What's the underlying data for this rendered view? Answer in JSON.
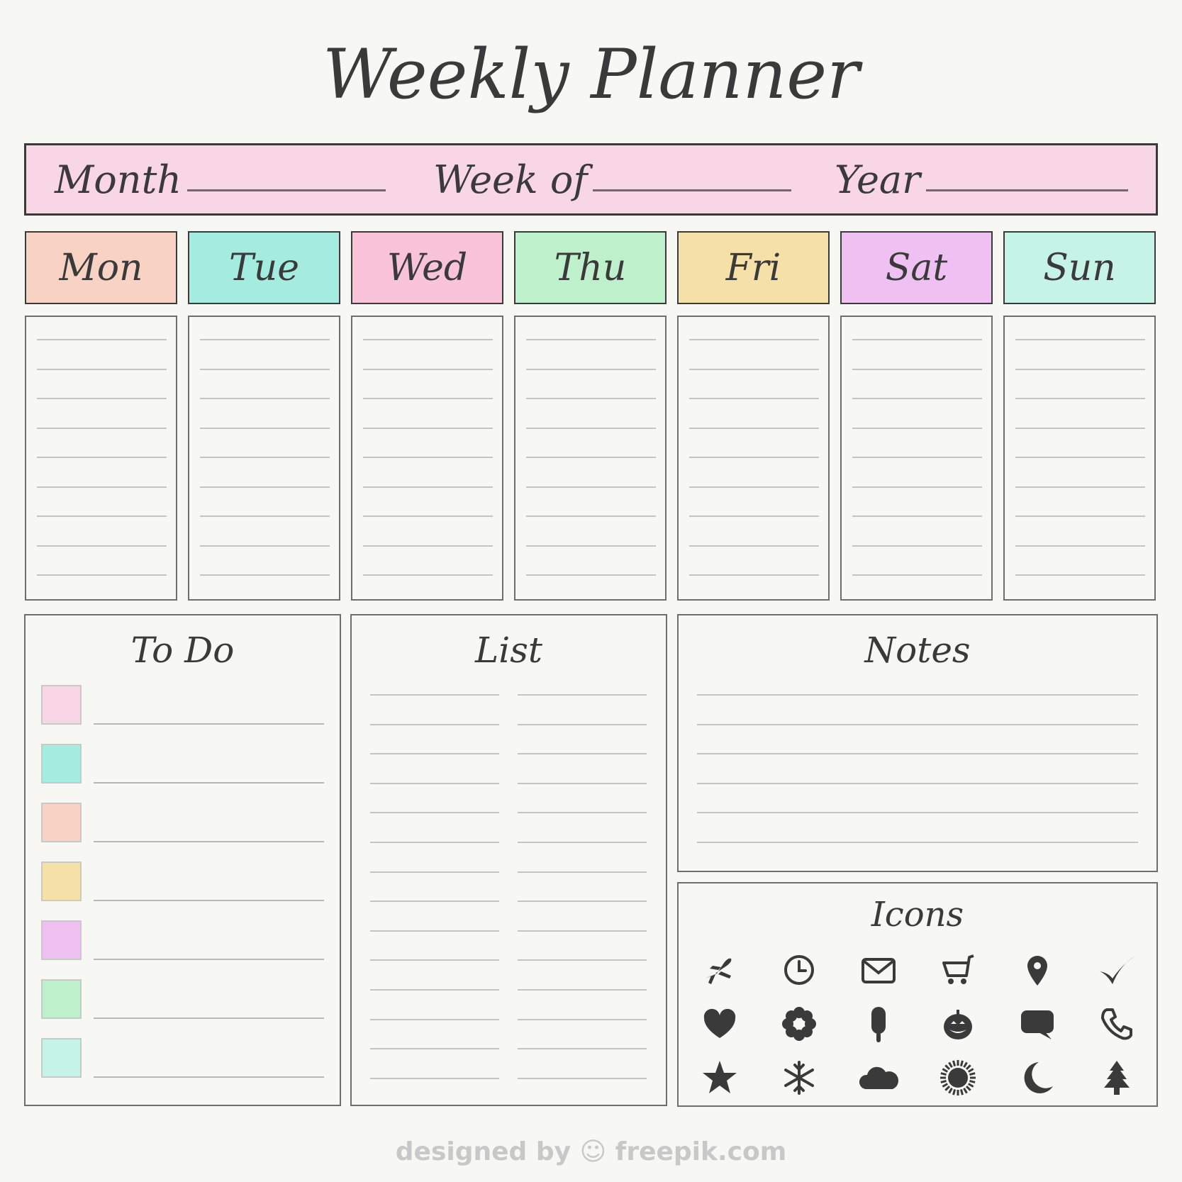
{
  "title": "Weekly Planner",
  "header": {
    "fields": [
      {
        "label": "Month"
      },
      {
        "label": "Week of"
      },
      {
        "label": "Year"
      }
    ],
    "color": "#f9d6e6"
  },
  "days": [
    {
      "label": "Mon",
      "color": "#f8d2c3"
    },
    {
      "label": "Tue",
      "color": "#a5ece0"
    },
    {
      "label": "Wed",
      "color": "#f9c3da"
    },
    {
      "label": "Thu",
      "color": "#bff0cc"
    },
    {
      "label": "Fri",
      "color": "#f5e0a8"
    },
    {
      "label": "Sat",
      "color": "#efc1f3"
    },
    {
      "label": "Sun",
      "color": "#c5f3e6"
    }
  ],
  "todo": {
    "title": "To Do",
    "colors": [
      "#f9d6e6",
      "#a5ece0",
      "#f8d2c3",
      "#f5e0a8",
      "#efc1f3",
      "#bff0cc",
      "#c5f3e6"
    ]
  },
  "list": {
    "title": "List"
  },
  "notes": {
    "title": "Notes"
  },
  "icons_panel": {
    "title": "Icons",
    "icons": [
      "airplane-icon",
      "clock-icon",
      "envelope-icon",
      "cart-icon",
      "location-pin-icon",
      "checkmark-icon",
      "heart-icon",
      "flower-icon",
      "popsicle-icon",
      "pumpkin-icon",
      "chat-bubble-icon",
      "phone-icon",
      "star-icon",
      "snowflake-icon",
      "cloud-icon",
      "sun-icon",
      "moon-icon",
      "tree-icon"
    ]
  },
  "footer": "designed by ☺ freepik.com"
}
